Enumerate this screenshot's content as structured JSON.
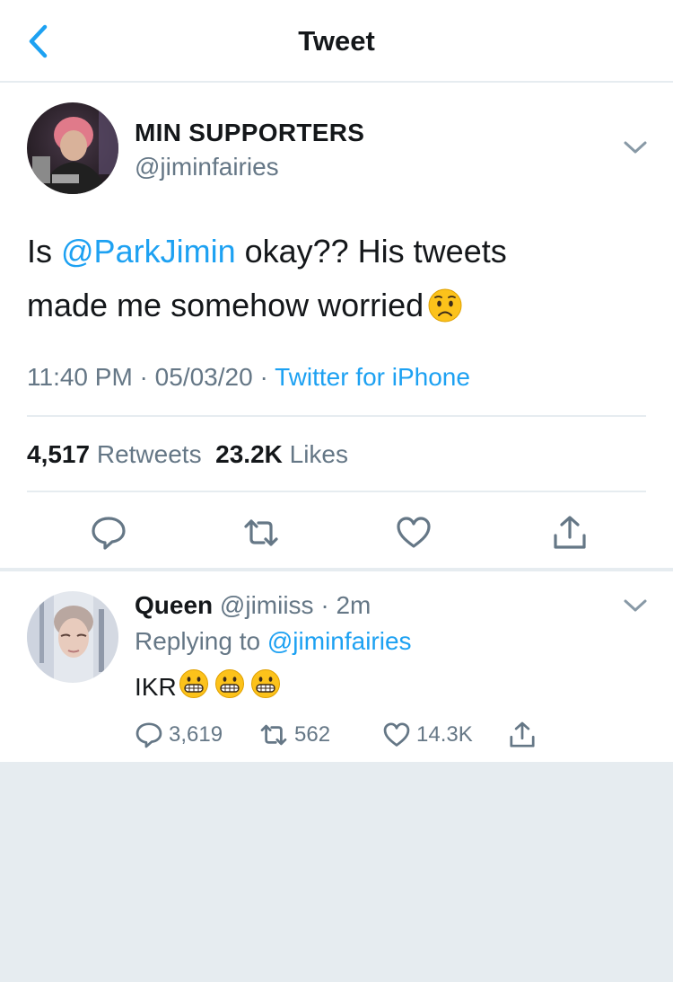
{
  "header": {
    "title": "Tweet",
    "back_icon": "chevron-left-icon",
    "accent": "#1da1f2"
  },
  "main_tweet": {
    "display_name": "MIN SUPPORTERS",
    "handle": "@jiminfairies",
    "text_prefix": "Is ",
    "mention": "@ParkJimin",
    "text_line1_rest": " okay?? His tweets",
    "text_line2": "made me somehow worried",
    "emoji": "worried-face",
    "time": "11:40 PM",
    "sep1": " · ",
    "date": "05/03/20",
    "sep2": " · ",
    "source": "Twitter for iPhone",
    "retweets_count": "4,517",
    "retweets_label": "Retweets",
    "likes_count": "23.2K",
    "likes_label": "Likes",
    "actions": [
      "reply-icon",
      "retweet-icon",
      "like-icon",
      "share-icon"
    ]
  },
  "reply": {
    "display_name": "Queen",
    "handle": "@jimiiss",
    "dot": " · ",
    "time": "2m",
    "replying_prefix": "Replying to ",
    "replying_to": "@jiminfairies",
    "text": "IKR",
    "emojis": [
      "grimacing-face",
      "grimacing-face",
      "grimacing-face"
    ],
    "reply_count": "3,619",
    "retweet_count": "562",
    "like_count": "14.3K"
  },
  "colors": {
    "text": "#14171a",
    "secondary": "#657786",
    "link": "#1da1f2",
    "divider": "#e6ecf0",
    "background": "#e6ecf0"
  }
}
